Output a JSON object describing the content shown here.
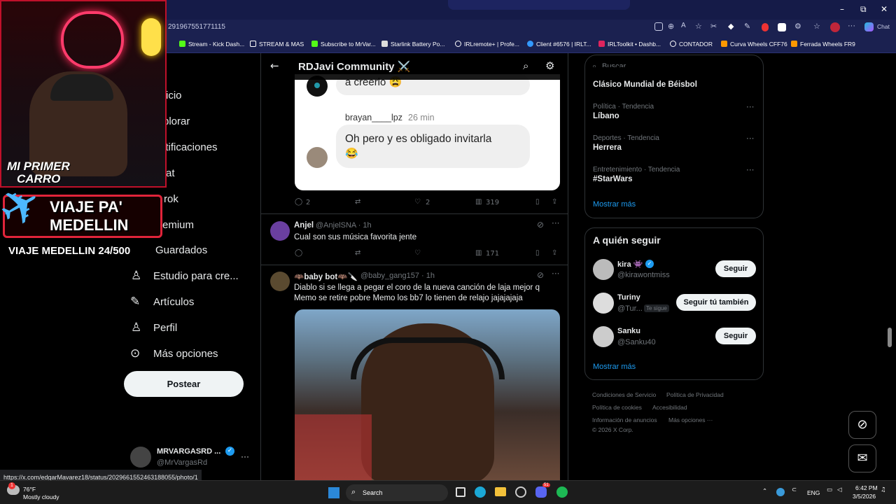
{
  "browser": {
    "url": "291967551771115",
    "chat_label": "Chat",
    "bookmarks": [
      "Stream - Kick Dash...",
      "STREAM & MAS",
      "Subscribe to MrVar...",
      "Starlink Battery Po...",
      "IRLremote+ | Profe...",
      "Client #6576 | IRLT...",
      "IRLToolkit • Dashb...",
      "CONTADOR",
      "Curva Wheels CFF76",
      "Ferrada Wheels FR9"
    ],
    "status_url": "https://x.com/edgarMavarez18/status/2029661552463188055/photo/1"
  },
  "left_nav": {
    "items": [
      "icio",
      "plorar",
      "otificaciones",
      "at",
      "rok",
      "emium",
      "Guardados",
      "Estudio para cre...",
      "Artículos",
      "Perfil",
      "Más opciones"
    ],
    "post_button": "Postear",
    "account_name": "MRVARGASRD ...",
    "account_handle": "@MrVargasRd",
    "more": "···"
  },
  "community": {
    "title": "RDJavi Community ⚔️",
    "quoted_card": {
      "prev_message": "a creerlo 😩",
      "reply_user": "brayan____lpz",
      "reply_time": "26 min",
      "reply_text_1": "Oh pero y es obligado invitarla",
      "reply_text_2": "😂"
    },
    "post1_actions": {
      "replies": "2",
      "reposts": "",
      "likes": "2",
      "views": "319"
    },
    "tweet2": {
      "name": "Anjel",
      "handle": "@AnjelSNA · 1h",
      "text": "Cual son sus música favorita jente",
      "views": "171"
    },
    "tweet3": {
      "name": "🦇baby bot🦇🔪",
      "handle": "@baby_gang157 · 1h",
      "text": "Diablo si se llega a pegar el coro de la nueva canción de laja mejor q Memo se retire pobre Memo los bb7 lo tienen de relajo jajajajaja"
    }
  },
  "right": {
    "search_placeholder": "Buscar",
    "trends": [
      {
        "meta": "",
        "name": "Clásico Mundial de Béisbol"
      },
      {
        "meta": "Política · Tendencia",
        "name": "Líbano"
      },
      {
        "meta": "Deportes · Tendencia",
        "name": "Herrera"
      },
      {
        "meta": "Entretenimiento · Tendencia",
        "name": "#StarWars"
      }
    ],
    "show_more": "Mostrar más",
    "who_to_follow": {
      "title": "A quién seguir",
      "accounts": [
        {
          "name": "kira 👾",
          "handle": "@kirawontmiss",
          "button": "Seguir",
          "badge": ""
        },
        {
          "name": "Turiny",
          "handle": "@Tur...",
          "button": "Seguir tú también",
          "badge": "Te sigue"
        },
        {
          "name": "Sanku",
          "handle": "@Sanku40",
          "button": "Seguir",
          "badge": ""
        }
      ],
      "show_more": "Mostrar más"
    },
    "footer": [
      "Condiciones de Servicio",
      "Política de Privacidad",
      "Política de cookies",
      "Accesibilidad",
      "Información de anuncios",
      "Más opciones ···",
      "© 2026 X Corp."
    ]
  },
  "overlay": {
    "line1": "MI PRIMER",
    "line2": "CARRO",
    "banner1": "VIAJE PA'",
    "banner2": "MEDELLIN",
    "counter": "VIAJE MEDELLIN 24/500"
  },
  "taskbar": {
    "temp": "76°F",
    "weather": "Mostly cloudy",
    "search": "Search",
    "lang": "ENG",
    "time": "6:42 PM",
    "date": "3/5/2026",
    "weather_badge": "1",
    "discord_badge": "51"
  },
  "colors": {
    "accent": "#1d9bf0",
    "taskbar": "#1c1c1c",
    "browser_chrome": "#1b2150"
  }
}
